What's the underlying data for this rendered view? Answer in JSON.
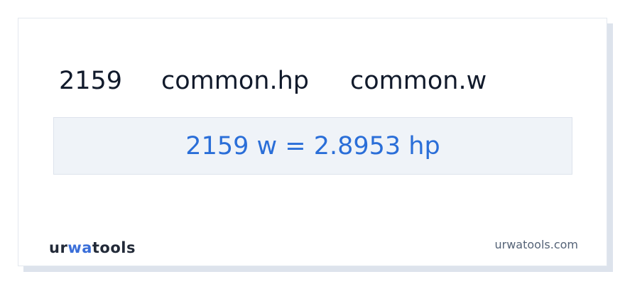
{
  "header": {
    "value": "2159",
    "from_unit": "common.hp",
    "to_unit": "common.w"
  },
  "result": {
    "text": "2159 w = 2.8953 hp"
  },
  "footer": {
    "logo_part1": "ur",
    "logo_accent": "wa",
    "logo_part2": "tools",
    "site_url": "urwatools.com"
  },
  "colors": {
    "accent": "#2a6ed8",
    "result_background": "#eff3f8",
    "text_dark": "#111a2b",
    "muted": "#556377"
  }
}
